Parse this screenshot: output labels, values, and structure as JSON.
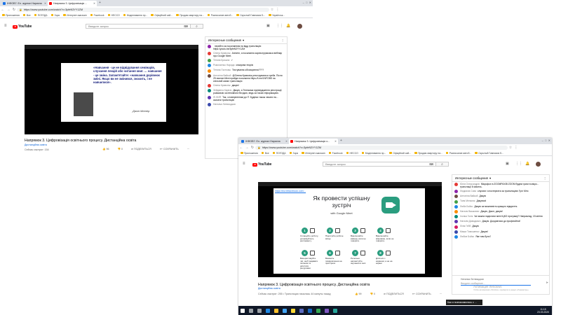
{
  "windowA": {
    "tabs": [
      {
        "label": "ІНФОВ7: Ел. журнал Нарисна",
        "color": "#1a73e8",
        "active": false
      },
      {
        "label": "Напрямок 3. Цифровізація ...",
        "color": "#ff0000",
        "active": true
      }
    ],
    "url": "https://www.youtube.com/watch?v=3pfeN3YY1ZM",
    "bookmarks": [
      "Приложения",
      "Все",
      "ПОГОДА",
      "Зоря",
      "Интернет-магазин",
      "Facebook",
      "НЕССО",
      "Моделювання пр...",
      "Офіційний сай...",
      "Продам квартиру на...",
      "Расписание автоб...",
      "Скрытый Гимназия Б...",
      "Українськ..."
    ],
    "search_placeholder": "Введите запрос",
    "video_title": "Напрямок 3. Цифровізація освітнього процесу. Дистанційна освіта",
    "channel": "Дистанційна освіта",
    "views": "Сейчас смотрят: 154",
    "likes": "96",
    "dislikes": "0",
    "share_label": "ПОДЕЛИТЬСЯ",
    "save_label": "СОХРАНИТЬ",
    "slide_quote": "«Навчання - це не відвідування семінарів, слухання лекцій або читання книг. … навчання - це зміна. Запам'ятайте: «навчання дорівнює зміні. Якщо ви не змінився, значить, і не навчилися».",
    "slide_author": "Джон Міллер",
    "chat_title": "Интересные сообщения",
    "chat": [
      {
        "author": "",
        "text": "перейти за посиланням на відд трансляцію https://youtu.be/3pfeN3YY1ZM",
        "color": "#8e24aa"
      },
      {
        "author": "Олена Кривохіж",
        "text": "Ангелін, я посилання зареєструвалася вебінар про Google Meet.",
        "color": "#e53935"
      },
      {
        "author": "Тетяна Кришна",
        "text": "✓",
        "color": "#43a047"
      },
      {
        "author": "Ромогаенко Нарида",
        "text": "спасуєва теорію",
        "color": "#1e88e5"
      },
      {
        "author": "Тетяна Палтовы",
        "text": "Тестування обговорення????",
        "color": "#fb8c00"
      },
      {
        "author": "Антоніна Вайкой",
        "text": "@Олена Кривохіж реєструватися треба. Після 25 хвилин Мені прийде посилання https://t.me/1NFOBS на спільний канал трансляцію",
        "color": "#6d4c41"
      },
      {
        "author": "Олена Кривохіж",
        "text": "дякую!",
        "color": "#e53935"
      },
      {
        "author": "Зейдинна Карією",
        "text": "Дякую, а Телекома підтвердження реєстрації, розмовою за неповною бесідою, ведь за такою інформацією.",
        "color": "#00897b"
      },
      {
        "author": "ЛІ.НИЯ",
        "text": "Так, з поверненням до ІТ. Будемо також чекати на... скачати трансляцію",
        "color": "#5e35b1"
      },
      {
        "author": "Наталья Литвиццкая",
        "text": "",
        "color": "#3949ab"
      }
    ],
    "taskbar_time": "",
    "taskbar_date": ""
  },
  "windowB": {
    "tabs": [
      {
        "label": "ІНФОВ7: Ел. журнал Нарисна",
        "color": "#1a73e8",
        "active": false
      },
      {
        "label": "Напрямок 3. Цифровізація о...",
        "color": "#ff0000",
        "active": true
      }
    ],
    "url": "https://www.youtube.com/watch?v=3pfeN3YY1ZM",
    "bookmarks": [
      "Приложения",
      "Все",
      "ПОГОДА",
      "Зоря",
      "Интернет-магазин",
      "Facebook",
      "НЕССО",
      "Моделювання пр...",
      "Офіційний сай...",
      "Продам квартиру на...",
      "Расписание автоб...",
      "Скрытый Гимназия Б..."
    ],
    "search_placeholder": "Введите запрос",
    "slide_link": "https://biz.bhfacebook.com/...",
    "slide_title": "Як провести успішну зустріч",
    "slide_subtitle": "with Google Meet",
    "steps": [
      {
        "n": "1",
        "text": "Сплануйте роботу, дотримуйтесь регламенту"
      },
      {
        "n": "2",
        "text": "Підготуйте робоче місце"
      },
      {
        "n": "3",
        "text": "Відключайте камеру, коли не говорите"
      },
      {
        "n": "4",
        "text": "Відключайте мікрофон, коли не говорите"
      },
      {
        "n": "5",
        "text": "Використовуйте чат, щоб задавати питання та ділитися ресурсами"
      },
      {
        "n": "6",
        "text": "Вимкніть повідомлення на пристроях"
      },
      {
        "n": "7",
        "text": "Ретельно налаштуйте звучання в залі"
      },
      {
        "n": "8",
        "text": "Діліться з екраном, а не на екрані"
      }
    ],
    "video_title": "Напрямок 3. Цифровізація освітнього процесу. Дистанційна освіта",
    "channel": "Дистанційна освіта",
    "views": "Сейчас смотрят: 255 • Трансляция началась 44 минуты назад",
    "likes": "99",
    "dislikes": "0",
    "share_label": "ПОДЕЛИТЬСЯ",
    "save_label": "СОХРАНИТЬ",
    "chat_title": "Интересные сообщения",
    "chat": [
      {
        "author": "Юлія Олександрів",
        "text": "Мікрофон в ZOOMРАХІВ ZOOM будем грати в мікро... трансляції й мисель.",
        "color": "#e53935"
      },
      {
        "author": "Людмила Сова",
        "text": "слухати і спостерігати за трансляцією Гугл Мітс",
        "color": "#8e24aa"
      },
      {
        "author": "Антоніна Вайкой",
        "text": "Дякую",
        "color": "#6d4c41"
      },
      {
        "author": "Таня Мельник",
        "text": "Дякуємо!",
        "color": "#43a047"
      },
      {
        "author": "Люба Бойко",
        "text": "Дякую за можливість кращого відкриття.",
        "color": "#1e88e5"
      },
      {
        "author": "Наталя Вашкович",
        "text": "Дякую, Джон, дякую!",
        "color": "#fb8c00"
      },
      {
        "author": "Ілонка Голік",
        "text": "Чи можна надіслати мені ІЦКО програму? Наприклад, 15 квітня",
        "color": "#00897b"
      },
      {
        "author": "Наталія Давидович",
        "text": "Дякую. Доєднатися до професійної!",
        "color": "#5e35b1"
      },
      {
        "author": "Лілія Гебб",
        "text": "Дякую",
        "color": "#d81b60"
      },
      {
        "author": "Маша Тимошенко",
        "text": "Дякую!",
        "color": "#3949ab"
      },
      {
        "author": "Любов Бойко",
        "text": "Яке там було?",
        "color": "#1e88e5"
      }
    ],
    "chat_author_bottom": "Наталья Литвиццкая",
    "chat_input_placeholder": "Вводите сообщение...",
    "watermark_title": "Активация Windows",
    "watermark_text": "Чтобы активировать Windows, перейдите в раздел «Параметры».",
    "popup_text": "Как я познакомилась с ...",
    "taskbar_time": "11:15",
    "taskbar_date": "23.03.2020"
  }
}
